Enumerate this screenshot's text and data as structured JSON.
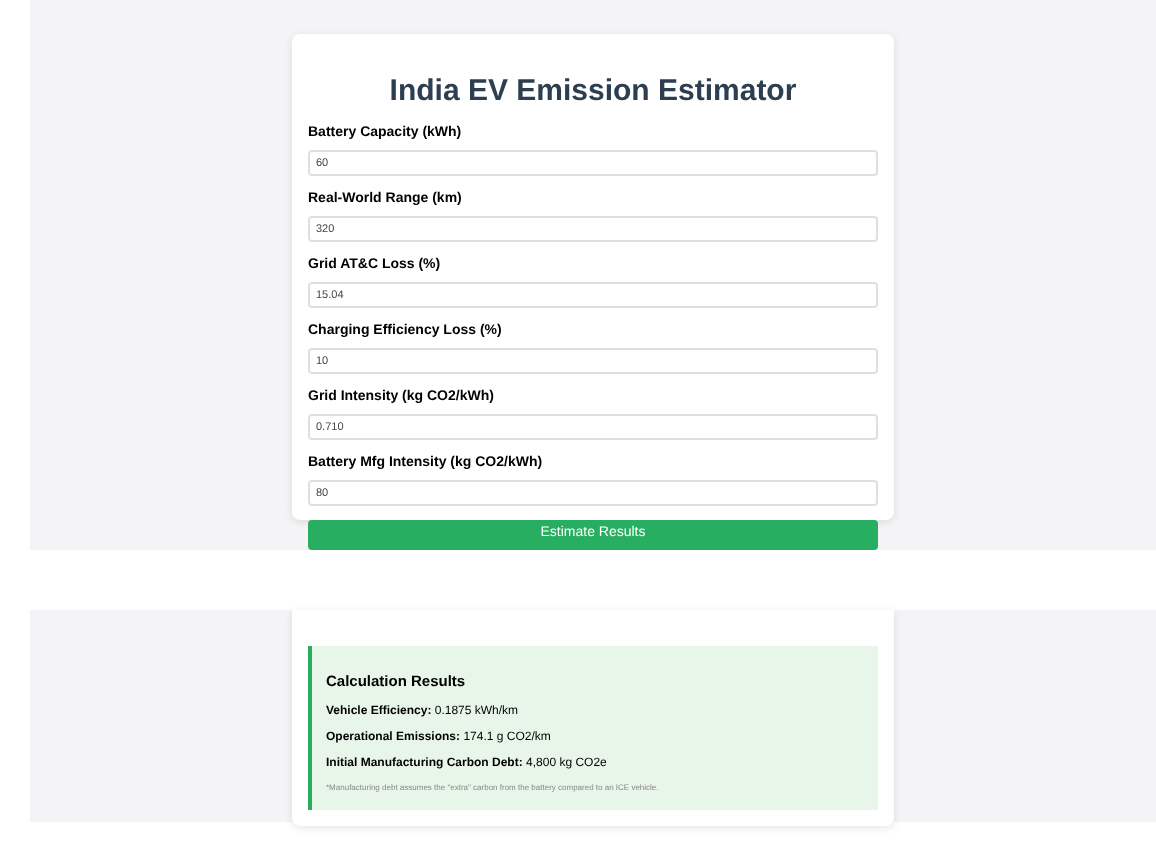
{
  "title": "India EV Emission Estimator",
  "fields": [
    {
      "label": "Battery Capacity (kWh)",
      "value": "60"
    },
    {
      "label": "Real-World Range (km)",
      "value": "320"
    },
    {
      "label": "Grid AT&C Loss (%)",
      "value": "15.04"
    },
    {
      "label": "Charging Efficiency Loss (%)",
      "value": "10"
    },
    {
      "label": "Grid Intensity (kg CO2/kWh)",
      "value": "0.710"
    },
    {
      "label": "Battery Mfg Intensity (kg CO2/kWh)",
      "value": "80"
    }
  ],
  "button": "Estimate Results",
  "results": {
    "title": "Calculation Results",
    "lines": [
      "**Vehicle Efficiency:** 0.1875 kWh/km",
      "**Operational Emissions:** 174.1 g CO2/km",
      "**Initial Manufacturing Carbon Debt:** 4,800 kg CO2e"
    ],
    "note": "*Manufacturing debt assumes the \"extra\" carbon from the battery compared to an ICE vehicle."
  }
}
